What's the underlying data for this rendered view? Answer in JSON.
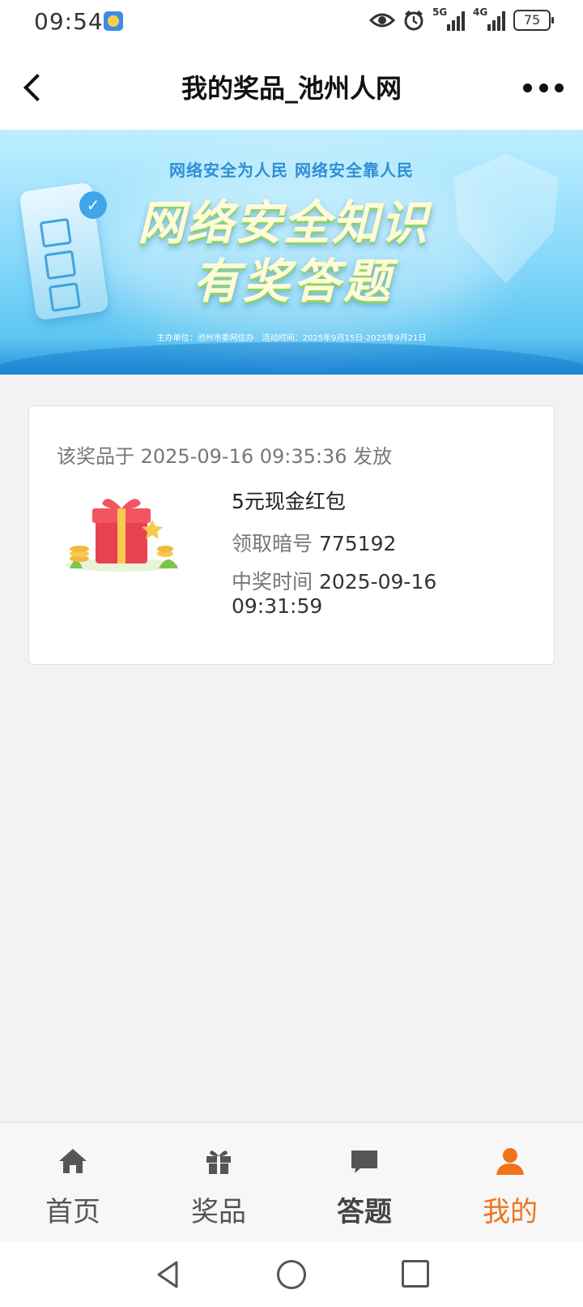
{
  "status_bar": {
    "time": "09:54",
    "signal_1_label": "5G",
    "signal_2_label": "4G",
    "battery": "75"
  },
  "header": {
    "title": "我的奖品_池州人网"
  },
  "banner": {
    "top_text": "网络安全为人民  网络安全靠人民",
    "headline_1": "网络安全知识",
    "headline_2": "有奖答题",
    "info": "主办单位：池州市委网信办　活动时间：2025年9月15日-2025年9月21日"
  },
  "prize": {
    "issued_text": "该奖品于 2025-09-16 09:35:36 发放",
    "name": "5元现金红包",
    "code_label": "领取暗号",
    "code_value": "775192",
    "win_time_label": "中奖时间",
    "win_time_value": "2025-09-16 09:31:59"
  },
  "tabs": [
    {
      "label": "首页",
      "icon": "home-icon"
    },
    {
      "label": "奖品",
      "icon": "gift-icon"
    },
    {
      "label": "答题",
      "icon": "chat-icon"
    },
    {
      "label": "我的",
      "icon": "user-icon"
    }
  ],
  "colors": {
    "accent": "#f0731c",
    "banner_blue": "#5cc5f2"
  }
}
